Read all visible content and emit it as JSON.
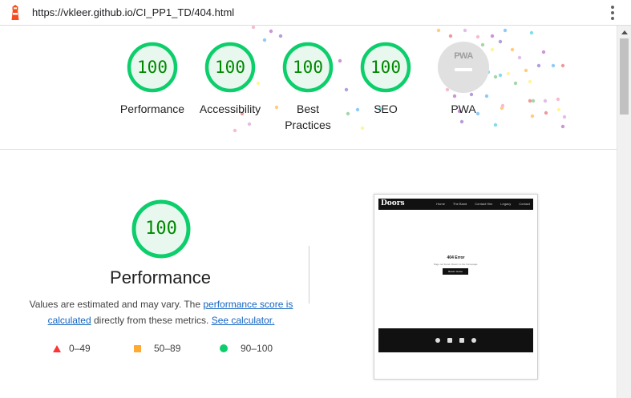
{
  "browser": {
    "url": "https://vkleer.github.io/CI_PP1_TD/404.html"
  },
  "summary": {
    "scores": [
      {
        "label": "Performance",
        "value": "100"
      },
      {
        "label": "Accessibility",
        "value": "100"
      },
      {
        "label": "Best Practices",
        "value": "100"
      },
      {
        "label": "SEO",
        "value": "100"
      },
      {
        "label": "PWA",
        "value": "PWA"
      }
    ]
  },
  "performance": {
    "score": "100",
    "title": "Performance",
    "desc_prefix": "Values are estimated and may vary. The ",
    "desc_link1": "performance score is calculated",
    "desc_middle": " directly from these metrics. ",
    "desc_link2": "See calculator."
  },
  "legend": {
    "fail": "0–49",
    "average": "50–89",
    "pass": "90–100"
  },
  "thumbnail": {
    "logo": "Doors",
    "nav_links": [
      "Home",
      "The Band",
      "Contact Him",
      "Legacy",
      "Contact"
    ],
    "heading": "404 Error",
    "subtext": "Page not found. Return to the homepage.",
    "button": "Return Home"
  },
  "colors": {
    "pass": "#0cce6b",
    "average": "#ffaa33",
    "fail": "#ff3333",
    "link": "#1565c0"
  }
}
